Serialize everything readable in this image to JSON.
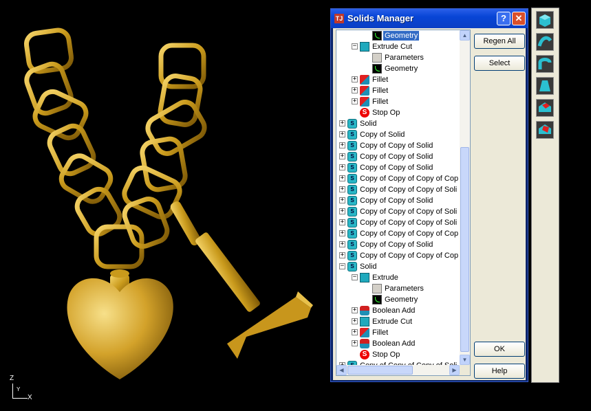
{
  "window": {
    "title": "Solids Manager",
    "help_glyph": "?",
    "close_glyph": "✕"
  },
  "tree": {
    "rows": [
      {
        "label": "Geometry",
        "icon": "geometry-icon",
        "level": 3,
        "expander": "",
        "selected": true
      },
      {
        "label": "Extrude Cut",
        "icon": "extrude-cut-icon",
        "level": 2,
        "expander": "−"
      },
      {
        "label": "Parameters",
        "icon": "folder-icon",
        "level": 3,
        "expander": ""
      },
      {
        "label": "Geometry",
        "icon": "geometry-icon",
        "level": 3,
        "expander": ""
      },
      {
        "label": "Fillet",
        "icon": "fillet-icon",
        "level": 2,
        "expander": "+"
      },
      {
        "label": "Fillet",
        "icon": "fillet-icon",
        "level": 2,
        "expander": "+"
      },
      {
        "label": "Fillet",
        "icon": "fillet-icon",
        "level": 2,
        "expander": "+"
      },
      {
        "label": "Stop Op",
        "icon": "stop-op-icon",
        "level": 2,
        "expander": ""
      },
      {
        "label": "Solid",
        "icon": "solid-icon",
        "level": 1,
        "expander": "+"
      },
      {
        "label": "Copy of Solid",
        "icon": "solid-icon",
        "level": 1,
        "expander": "+"
      },
      {
        "label": "Copy of Copy of Solid",
        "icon": "solid-icon",
        "level": 1,
        "expander": "+"
      },
      {
        "label": "Copy of Copy of Solid",
        "icon": "solid-icon",
        "level": 1,
        "expander": "+"
      },
      {
        "label": "Copy of Copy of Solid",
        "icon": "solid-icon",
        "level": 1,
        "expander": "+"
      },
      {
        "label": "Copy of Copy of Copy of Cop",
        "icon": "solid-icon",
        "level": 1,
        "expander": "+"
      },
      {
        "label": "Copy of Copy of Copy of Soli",
        "icon": "solid-icon",
        "level": 1,
        "expander": "+"
      },
      {
        "label": "Copy of Copy of Solid",
        "icon": "solid-icon",
        "level": 1,
        "expander": "+"
      },
      {
        "label": "Copy of Copy of Copy of Soli",
        "icon": "solid-icon",
        "level": 1,
        "expander": "+"
      },
      {
        "label": "Copy of Copy of Copy of Soli",
        "icon": "solid-icon",
        "level": 1,
        "expander": "+"
      },
      {
        "label": "Copy of Copy of Copy of Cop",
        "icon": "solid-icon",
        "level": 1,
        "expander": "+"
      },
      {
        "label": "Copy of Copy of Solid",
        "icon": "solid-icon",
        "level": 1,
        "expander": "+"
      },
      {
        "label": "Copy of Copy of Copy of Cop",
        "icon": "solid-icon",
        "level": 1,
        "expander": "+"
      },
      {
        "label": "Solid",
        "icon": "solid-icon",
        "level": 1,
        "expander": "−"
      },
      {
        "label": "Extrude",
        "icon": "extrude-icon",
        "level": 2,
        "expander": "−"
      },
      {
        "label": "Parameters",
        "icon": "folder-icon",
        "level": 3,
        "expander": ""
      },
      {
        "label": "Geometry",
        "icon": "geometry-icon",
        "level": 3,
        "expander": ""
      },
      {
        "label": "Boolean Add",
        "icon": "boolean-add-icon",
        "level": 2,
        "expander": "+"
      },
      {
        "label": "Extrude Cut",
        "icon": "extrude-cut-icon",
        "level": 2,
        "expander": "+"
      },
      {
        "label": "Fillet",
        "icon": "fillet-icon",
        "level": 2,
        "expander": "+"
      },
      {
        "label": "Boolean Add",
        "icon": "boolean-add-icon",
        "level": 2,
        "expander": "+"
      },
      {
        "label": "Stop Op",
        "icon": "stop-op-icon",
        "level": 2,
        "expander": ""
      },
      {
        "label": "Copy of Copy of Copy of Soli",
        "icon": "solid-icon",
        "level": 1,
        "expander": "+"
      }
    ]
  },
  "buttons": {
    "regen_all": "Regen All",
    "select": "Select",
    "ok": "OK",
    "help": "Help"
  },
  "axis": {
    "z": "Z",
    "y": "Y",
    "x": "X"
  },
  "toolbar": {
    "tools": [
      "box-tool-icon",
      "sweep-tool-icon",
      "revolve-tool-icon",
      "loft-tool-icon",
      "fillet-tool-icon",
      "chamfer-tool-icon"
    ]
  },
  "colors": {
    "gold": "#d4a017",
    "selection": "#316ac5",
    "title_bar": "#0845d6"
  }
}
